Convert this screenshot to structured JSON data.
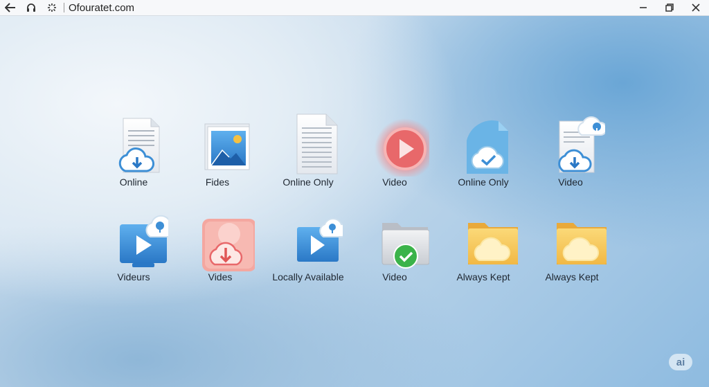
{
  "window": {
    "title": "Ofouratet.com"
  },
  "toolbar": {
    "back_icon": "back-arrow-icon",
    "headphones_icon": "headphones-icon",
    "settings_icon": "sparkle-gear-icon"
  },
  "window_controls": [
    "minimize",
    "restore",
    "close"
  ],
  "items": [
    {
      "label": "Online",
      "icon": "document-cloud-download-icon"
    },
    {
      "label": "Fides",
      "icon": "image-file-icon"
    },
    {
      "label": "Online Only",
      "icon": "text-document-icon"
    },
    {
      "label": "Video",
      "icon": "video-play-icon"
    },
    {
      "label": "Online Only",
      "icon": "cloud-check-document-icon"
    },
    {
      "label": "Video",
      "icon": "document-cloud-download-icon"
    },
    {
      "label": "Videurs",
      "icon": "video-screen-cloud-icon"
    },
    {
      "label": "Vides",
      "icon": "cloud-download-tile-icon"
    },
    {
      "label": "Locally Available",
      "icon": "video-clip-cloud-icon"
    },
    {
      "label": "Video",
      "icon": "folder-check-icon"
    },
    {
      "label": "Always Kept",
      "icon": "folder-cloud-icon"
    },
    {
      "label": "Always Kept",
      "icon": "folder-cloud-icon"
    }
  ],
  "watermark": "ai",
  "colors": {
    "accent": "#3d8fd6",
    "video_red": "#e8686a",
    "folder_yellow": "#f5c85a",
    "check_green": "#3bb34a"
  }
}
